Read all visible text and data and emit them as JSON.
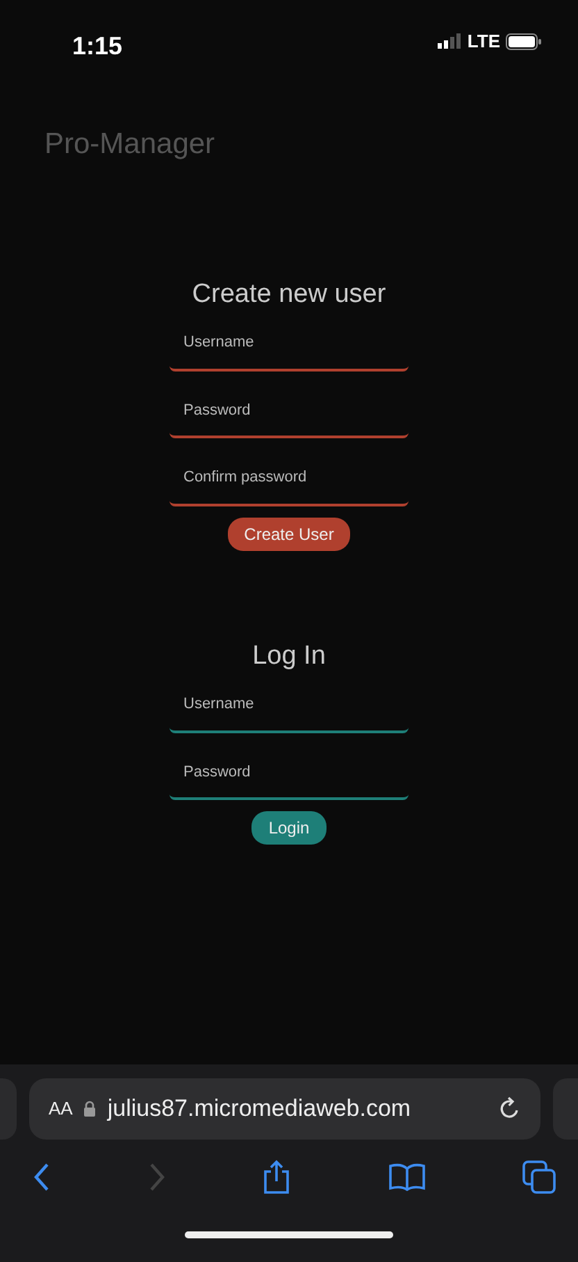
{
  "status_bar": {
    "time": "1:15",
    "network": "LTE"
  },
  "app_title": "Pro-Manager",
  "forms": [
    {
      "title": "Create new user",
      "color": "#b0402e",
      "fields": [
        {
          "placeholder": "Username"
        },
        {
          "placeholder": "Password"
        },
        {
          "placeholder": "Confirm password"
        }
      ],
      "button": "Create User"
    },
    {
      "title": "Log In",
      "color": "#1e7f78",
      "fields": [
        {
          "placeholder": "Username"
        },
        {
          "placeholder": "Password"
        }
      ],
      "button": "Login"
    }
  ],
  "browser": {
    "text_size": "AA",
    "url": "julius87.micromediaweb.com",
    "forward_disabled": true
  }
}
